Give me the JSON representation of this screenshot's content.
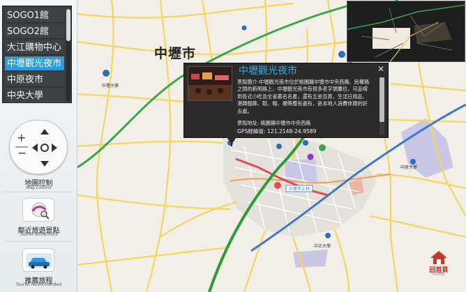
{
  "map": {
    "city_label": "中壢市",
    "road_labels": [
      "中壢市上林"
    ],
    "poi_labels": [
      "中壢大學",
      "中原大學",
      "中正大學"
    ]
  },
  "menu": {
    "items": [
      {
        "label": "SOGO1館"
      },
      {
        "label": "SOGO2館"
      },
      {
        "label": "大江購物中心"
      },
      {
        "label": "中壢觀光夜市",
        "selected": true
      },
      {
        "label": "中原夜市"
      },
      {
        "label": "中央大學"
      }
    ]
  },
  "controls": {
    "map_control": {
      "label": "地圖控制",
      "sub": "Map Control"
    },
    "attractions": {
      "label": "鄰近旅遊景點",
      "sub": "Tourist Attractions"
    },
    "recommended": {
      "label": "推薦旅程",
      "sub": "Tourist recommended"
    }
  },
  "popup": {
    "title": "中壢觀光夜市",
    "close": "✕",
    "description": "景點簡介:中壢觀光夜市位於桃園縣中壢市中央西路、民權路之間的新明路上，中壢觀光夜市有很多老字號攤位，可品嚐到各式小吃及全省著名名產，還有五金百貨、生活日用品、港韓服飾、鞋、帽、襪等應有盡有，是本地人消費休閒的好去處。",
    "address": "景點地址: 桃園縣中壢市中央西路",
    "gps": "GPS經緯度: 121.2148-24.9589"
  },
  "home": {
    "label": "回首頁",
    "sub": "HOME"
  },
  "colors": {
    "accent": "#2f9ad8",
    "popup_title": "#3fa9e0",
    "highway": "#2e9b35",
    "trunk_road": "#3f78c9",
    "local_road": "#f7d55a"
  }
}
